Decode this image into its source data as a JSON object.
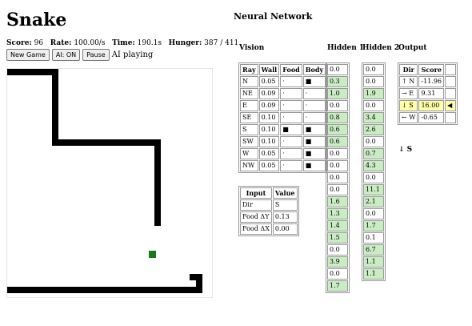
{
  "title": "Snake",
  "stats": {
    "score_label": "Score:",
    "score": "96",
    "rate_label": "Rate:",
    "rate": "100.00/s",
    "time_label": "Time:",
    "time": "190.1s",
    "hunger_label": "Hunger:",
    "hunger": "387 / 411"
  },
  "controls": {
    "new_game": "New Game",
    "ai_toggle": "AI: ON",
    "pause": "Pause",
    "status": "AI playing"
  },
  "nn": {
    "title": "Neural Network",
    "vision_label": "Vision",
    "hidden1_label": "Hidden 1",
    "hidden2_label": "Hidden 2",
    "output_label": "Output",
    "vision_headers": [
      "Ray",
      "Wall",
      "Food",
      "Body"
    ],
    "vision_rows": [
      [
        "N",
        "0.05",
        "·",
        "■"
      ],
      [
        "NE",
        "0.09",
        "·",
        "·"
      ],
      [
        "E",
        "0.09",
        "·",
        "·"
      ],
      [
        "SE",
        "0.10",
        "·",
        "·"
      ],
      [
        "S",
        "0.10",
        "■",
        "■"
      ],
      [
        "SW",
        "0.10",
        "·",
        "■"
      ],
      [
        "W",
        "0.05",
        "·",
        "■"
      ],
      [
        "NW",
        "0.05",
        "·",
        "■"
      ]
    ],
    "input_headers": [
      "Input",
      "Value"
    ],
    "input_rows": [
      [
        "Dir",
        "S"
      ],
      [
        "Food ΔY",
        "0.13"
      ],
      [
        "Food ΔX",
        "0.00"
      ]
    ],
    "hidden1": [
      "0.0",
      "0.3",
      "1.0",
      "0.0",
      "0.8",
      "0.6",
      "0.6",
      "0.0",
      "0.0",
      "0.0",
      "0.0",
      "1.6",
      "1.3",
      "1.4",
      "1.5",
      "0.0",
      "3.9",
      "0.0",
      "1.7"
    ],
    "hidden1_active": [
      false,
      true,
      true,
      false,
      true,
      true,
      true,
      false,
      false,
      false,
      false,
      true,
      true,
      true,
      true,
      false,
      true,
      false,
      true
    ],
    "hidden2": [
      "0.0",
      "0.0",
      "1.9",
      "0.0",
      "3.4",
      "2.6",
      "0.0",
      "0.7",
      "4.3",
      "0.0",
      "11.1",
      "2.1",
      "0.0",
      "1.7",
      "0.1",
      "6.7",
      "1.1",
      "1.1"
    ],
    "hidden2_active": [
      false,
      false,
      true,
      false,
      true,
      true,
      false,
      true,
      true,
      false,
      true,
      true,
      false,
      true,
      false,
      true,
      true,
      true
    ],
    "output_headers": [
      "Dir",
      "Score"
    ],
    "output_rows": [
      {
        "dir": "↑ N",
        "score": "-11.96",
        "mark": ""
      },
      {
        "dir": "→ E",
        "score": "9.31",
        "mark": ""
      },
      {
        "dir": "↓ S",
        "score": "16.00",
        "mark": "◀",
        "selected": true
      },
      {
        "dir": "← W",
        "score": "-0.65",
        "mark": ""
      }
    ],
    "chosen_direction": "↓ S"
  },
  "colors": {
    "active_cell": "#c9ecc3",
    "selected_row": "#ffffa8",
    "food": "#1a7a1a",
    "snake": "#000000"
  }
}
